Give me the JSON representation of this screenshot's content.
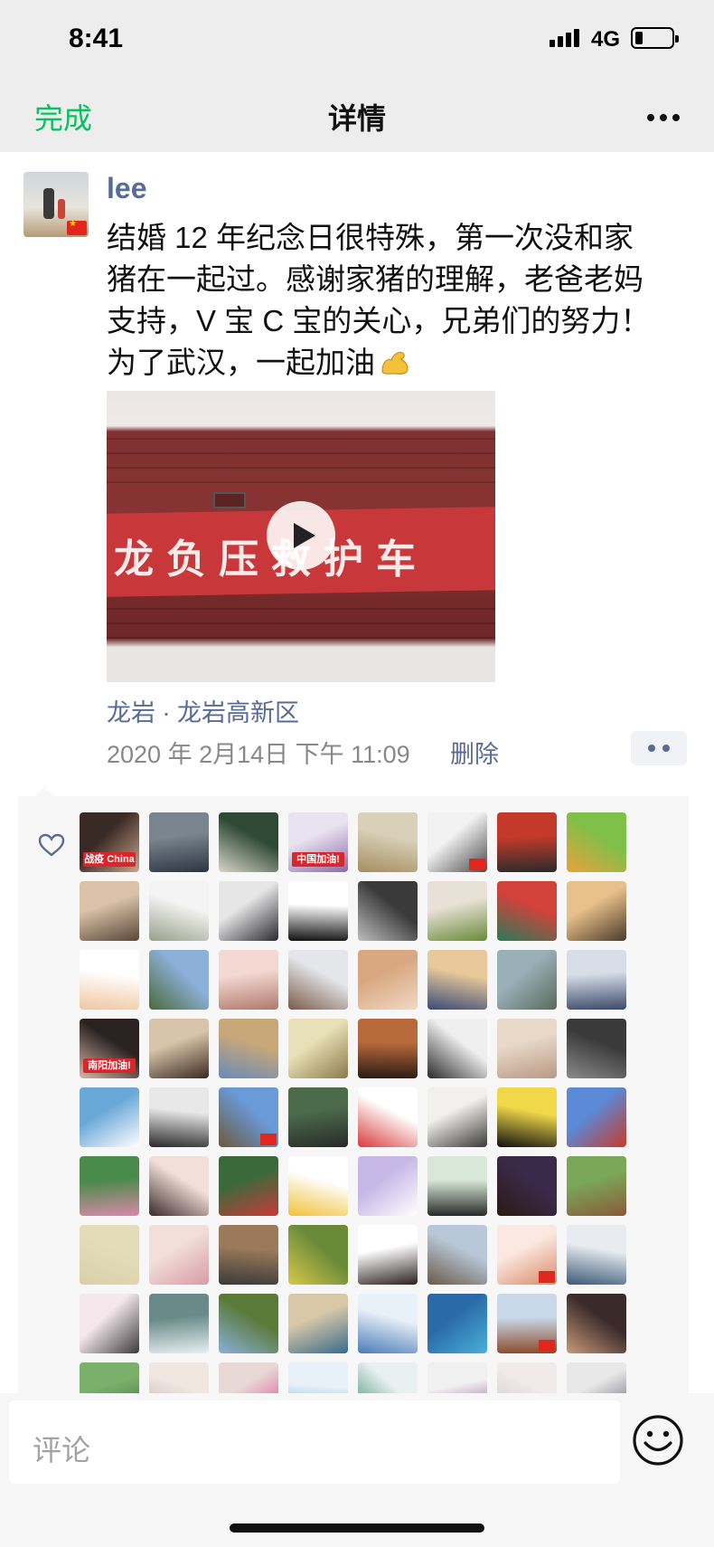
{
  "status_bar": {
    "time": "8:41",
    "network": "4G",
    "battery_level": 0.2
  },
  "nav": {
    "done_label": "完成",
    "title": "详情",
    "more_icon": "ellipsis-icon"
  },
  "post": {
    "username": "lee",
    "text_lines": [
      "结婚 12 年纪念日很特殊，第一次没和家",
      "猪在一起过。感谢家猪的理解，老爸老妈",
      "支持，V 宝 C 宝的关心，兄弟们的努力！",
      "为了武汉，一起加油"
    ],
    "emoji": "flexed-biceps-emoji",
    "video": {
      "banner_text": "龙负压救护车"
    },
    "location": "龙岩 · 龙岩高新区",
    "timestamp": "2020 年 2月14日 下午 11:09",
    "delete_label": "删除"
  },
  "likes": {
    "avatars": [
      {
        "colors": [
          "#3a2a25",
          "#c9a58a"
        ],
        "badge": "战疫 China"
      },
      {
        "colors": [
          "#7a8590",
          "#2c3440"
        ]
      },
      {
        "colors": [
          "#2e4a36",
          "#d9d4c6"
        ]
      },
      {
        "colors": [
          "#e9e2f0",
          "#8a6aa8"
        ],
        "badge": "中国加油!"
      },
      {
        "colors": [
          "#d8d0b8",
          "#a58e60"
        ]
      },
      {
        "colors": [
          "#f2f2f2",
          "#4a4a4a"
        ],
        "flag": true
      },
      {
        "colors": [
          "#c43a2a",
          "#2b2b2b"
        ]
      },
      {
        "colors": [
          "#7fc04a",
          "#e9a23c"
        ]
      },
      {
        "colors": [
          "#d9c2a8",
          "#5a4638"
        ]
      },
      {
        "colors": [
          "#f4f4f4",
          "#9aa08a"
        ]
      },
      {
        "colors": [
          "#e6e6e6",
          "#2a2a30"
        ]
      },
      {
        "colors": [
          "#ffffff",
          "#111111"
        ]
      },
      {
        "colors": [
          "#3a3a3a",
          "#bdbdbd"
        ]
      },
      {
        "colors": [
          "#e8e2d6",
          "#6a8a3a"
        ]
      },
      {
        "colors": [
          "#d2413a",
          "#2a7a58"
        ]
      },
      {
        "colors": [
          "#e8c08a",
          "#4a3a2a"
        ]
      },
      {
        "colors": [
          "#ffffff",
          "#f0c7a0"
        ]
      },
      {
        "colors": [
          "#8cb0d8",
          "#4a6a3a"
        ]
      },
      {
        "colors": [
          "#f3d9d2",
          "#b07a6a"
        ]
      },
      {
        "colors": [
          "#e4e6ea",
          "#7a5a48"
        ]
      },
      {
        "colors": [
          "#d9a882",
          "#f0d9c2"
        ]
      },
      {
        "colors": [
          "#e8c89a",
          "#3a4a78"
        ]
      },
      {
        "colors": [
          "#9ab0b8",
          "#5a6a5a"
        ]
      },
      {
        "colors": [
          "#d8dee8",
          "#3a4a6a"
        ]
      },
      {
        "colors": [
          "#2a2222",
          "#d8b8a8"
        ],
        "badge": "南阳加油!"
      },
      {
        "colors": [
          "#d8c4a8",
          "#3a2a22"
        ]
      },
      {
        "colors": [
          "#c8a878",
          "#6a8ab8"
        ]
      },
      {
        "colors": [
          "#e8e0b8",
          "#8a7a48"
        ]
      },
      {
        "colors": [
          "#b86a3a",
          "#2a1a14"
        ]
      },
      {
        "colors": [
          "#efefef",
          "#2a2a2a"
        ]
      },
      {
        "colors": [
          "#e8d8c8",
          "#b89a84"
        ]
      },
      {
        "colors": [
          "#3a3a3a",
          "#8a8a8a"
        ]
      },
      {
        "colors": [
          "#6aa8d8",
          "#ffffff"
        ]
      },
      {
        "colors": [
          "#e8e8e8",
          "#2a2a2a"
        ]
      },
      {
        "colors": [
          "#6a9ad8",
          "#6a5a3a"
        ],
        "flag": true
      },
      {
        "colors": [
          "#4a6a4a",
          "#2a2a2a"
        ]
      },
      {
        "colors": [
          "#ffffff",
          "#d83a3a"
        ]
      },
      {
        "colors": [
          "#f2f0ec",
          "#3a3a3a"
        ]
      },
      {
        "colors": [
          "#f0d84a",
          "#111111"
        ]
      },
      {
        "colors": [
          "#5a8ad8",
          "#c83a2a"
        ]
      },
      {
        "colors": [
          "#4a8a4a",
          "#d88aa8"
        ]
      },
      {
        "colors": [
          "#f2e0d8",
          "#3a2a2a"
        ]
      },
      {
        "colors": [
          "#3a6a3a",
          "#c83a3a"
        ]
      },
      {
        "colors": [
          "#ffffff",
          "#f0c23a"
        ]
      },
      {
        "colors": [
          "#c8b8e8",
          "#ffffff"
        ]
      },
      {
        "colors": [
          "#d8e8d8",
          "#2a2a2a"
        ]
      },
      {
        "colors": [
          "#3a2a4a",
          "#2a1a14"
        ]
      },
      {
        "colors": [
          "#7aa858",
          "#8a5a3a"
        ]
      },
      {
        "colors": [
          "#e4dcb8",
          "#d8d0a8"
        ]
      },
      {
        "colors": [
          "#f2e0d8",
          "#d89aa8"
        ]
      },
      {
        "colors": [
          "#9a7a5a",
          "#3a3a3a"
        ]
      },
      {
        "colors": [
          "#6a8a3a",
          "#d8c84a"
        ]
      },
      {
        "colors": [
          "#ffffff",
          "#2a2020"
        ]
      },
      {
        "colors": [
          "#b8c8d8",
          "#6a5a4a"
        ]
      },
      {
        "colors": [
          "#fbe8e0",
          "#d88a6a"
        ],
        "flag": true
      },
      {
        "colors": [
          "#e8ecf0",
          "#3a5a78"
        ]
      },
      {
        "colors": [
          "#f4e8ec",
          "#3a3a3a"
        ]
      },
      {
        "colors": [
          "#6a8a8a",
          "#e8f0f0"
        ]
      },
      {
        "colors": [
          "#5a7a3a",
          "#8ab0d8"
        ]
      },
      {
        "colors": [
          "#d8c8a8",
          "#3a6a8a"
        ]
      },
      {
        "colors": [
          "#e8f0f8",
          "#4a7ab8"
        ]
      },
      {
        "colors": [
          "#2a6aa8",
          "#4ab0d8"
        ]
      },
      {
        "colors": [
          "#c8d8e8",
          "#8a4a2a"
        ],
        "flag": true
      },
      {
        "colors": [
          "#3a2a2a",
          "#c89a7a"
        ]
      },
      {
        "colors": [
          "#7ab06a",
          "#3a6a3a"
        ]
      },
      {
        "colors": [
          "#f0e8e0",
          "#c8a8b8"
        ]
      },
      {
        "colors": [
          "#e8d8d8",
          "#d84a8a"
        ]
      },
      {
        "colors": [
          "#e8f0f8",
          "#3ab0d8"
        ]
      },
      {
        "colors": [
          "#e8f0f0",
          "#3a8a6a"
        ]
      },
      {
        "colors": [
          "#f0f0f0",
          "#8a3a8a"
        ]
      },
      {
        "colors": [
          "#f0eaea",
          "#c8c8c8"
        ]
      },
      {
        "colors": [
          "#e8e8e8",
          "#5a5a6a"
        ]
      }
    ]
  },
  "comment": {
    "placeholder": "评论",
    "emoji_icon": "smiley-icon"
  }
}
